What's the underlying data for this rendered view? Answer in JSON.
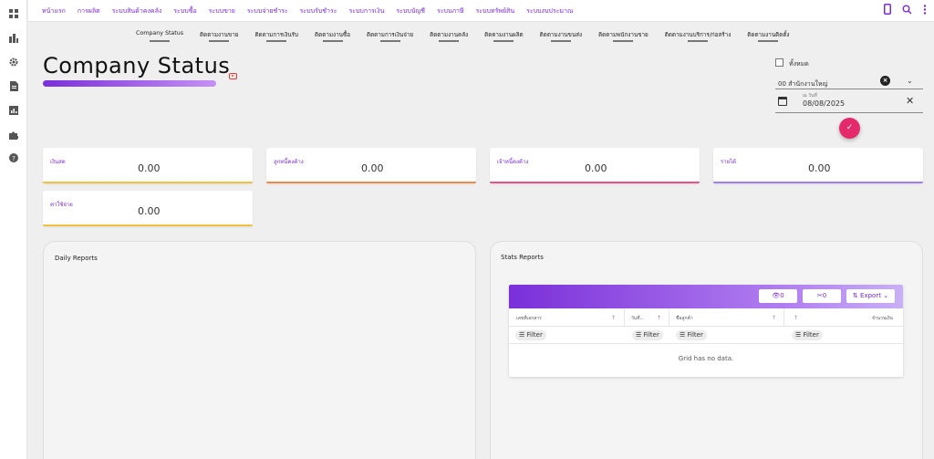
{
  "topnav": [
    "หน้าแรก",
    "การผลิต",
    "ระบบสินค้าคงคลัง",
    "ระบบซื้อ",
    "ระบบขาย",
    "ระบบจ่ายชำระ",
    "ระบบรับชำระ",
    "ระบบการเงิน",
    "ระบบบัญชี",
    "ระบบภาษี",
    "ระบบทรัพย์สิน",
    "ระบบงบประมาณ"
  ],
  "subnav": [
    "Company Status",
    "ติดตามงานขาย",
    "ติดตามการเงินรับ",
    "ติดตามงานซื้อ",
    "ติดตามการเงินจ่าย",
    "ติดตามงานคลัง",
    "ติดตามงานผลิต",
    "ติดตามงานขนส่ง",
    "ติดตามพนักงานขาย",
    "ติดตามงานบริการ/ก่อสร้าง",
    "ติดตามงานติดตั้ง"
  ],
  "page": {
    "title": "Company Status"
  },
  "filter": {
    "all_label": "ทั้งหมด",
    "branch_value": "00 สำนักงานใหญ่",
    "date_label": "ณ วันที่",
    "date_value": "08/08/2025"
  },
  "cards": [
    {
      "label": "เงินสด",
      "value": "0.00",
      "color": "#f0c040"
    },
    {
      "label": "ลูกหนี้คงค้าง",
      "value": "0.00",
      "color": "#f08a4b"
    },
    {
      "label": "เจ้าหนี้คงค้าง",
      "value": "0.00",
      "color": "#e8508a"
    },
    {
      "label": "รายได้",
      "value": "0.00",
      "color": "#a07ef0"
    },
    {
      "label": "ค่าใช้จ่าย",
      "value": "0.00",
      "color": "#f0c040"
    }
  ],
  "daily": {
    "title": "Daily Reports"
  },
  "stats": {
    "title": "Stats Reports",
    "btn_view": "0",
    "btn_hide": "0",
    "btn_export": "Export",
    "columns": [
      "เลขที่เอกสาร",
      "วันที่...",
      "ชื่อลูกค้า",
      "",
      "จำนวนเงิน"
    ],
    "filter_label": "Filter",
    "empty": "Grid has no data."
  },
  "icons": [
    "dashboard-icon",
    "bank-icon",
    "settings-icon",
    "document-icon",
    "report-icon",
    "puzzle-icon",
    "help-icon",
    "phone-icon",
    "search-icon",
    "more-vert-icon"
  ]
}
